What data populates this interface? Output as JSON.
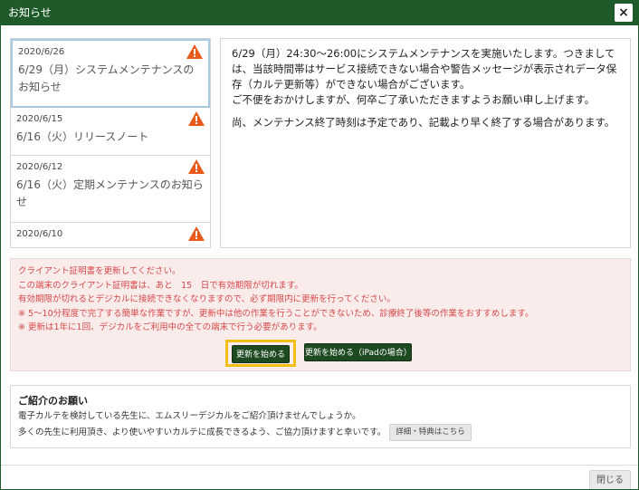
{
  "dialog": {
    "title": "お知らせ",
    "close_icon_label": "×"
  },
  "notices": [
    {
      "date": "2020/6/26",
      "title": "6/29（月）システムメンテナンスのお知らせ",
      "icon": "warning-icon"
    },
    {
      "date": "2020/6/15",
      "title": "6/16（火）リリースノート",
      "icon": "warning-icon"
    },
    {
      "date": "2020/6/12",
      "title": "6/16（火）定期メンテナンスのお知らせ",
      "icon": "warning-icon"
    },
    {
      "date": "2020/6/10",
      "title": "",
      "icon": "warning-icon"
    }
  ],
  "detail": {
    "paragraph1": "6/29（月）24:30〜26:00にシステムメンテナンスを実施いたします。つきましては、当該時間帯はサービス接続できない場合や警告メッセージが表示されデータ保存（カルテ更新等）ができない場合がございます。",
    "paragraph2": "ご不便をおかけしますが、何卒ご了承いただきますようお願い申し上げます。",
    "paragraph3": "尚、メンテナンス終了時刻は予定であり、記載より早く終了する場合があります。"
  },
  "certificate": {
    "line1": "クライアント証明書を更新してください。",
    "line2": "この端末のクライアント証明書は、あと　15　日で有効期限が切れます。",
    "line3": "有効期限が切れるとデジカルに接続できなくなりますので、必ず期限内に更新を行ってください。",
    "line4": "※ 5〜10分程度で完了する簡単な作業ですが、更新中は他の作業を行うことができないため、診療終了後等の作業をおすすめします。",
    "line5": "※ 更新は1年に1回、デジカルをご利用中の全ての端末で行う必要があります。",
    "start_button": "更新を始める",
    "ipad_button": "更新を始める（iPadの場合）"
  },
  "intro": {
    "heading": "ご紹介のお願い",
    "line1": "電子カルテを検討している先生に、エムスリーデジカルをご紹介頂けませんでしょうか。",
    "line2": "多くの先生に利用頂き、より使いやすいカルテに成長できるよう、ご協力頂けますと幸いです。",
    "detail_button": "詳細・特典はこちら"
  },
  "footer": {
    "close_button": "閉じる"
  },
  "colors": {
    "titlebar": "#1e5a2a",
    "warning": "#e8591a",
    "cert_text": "#d64848",
    "cert_bg": "#fbecec",
    "highlight": "#f2bf16"
  }
}
